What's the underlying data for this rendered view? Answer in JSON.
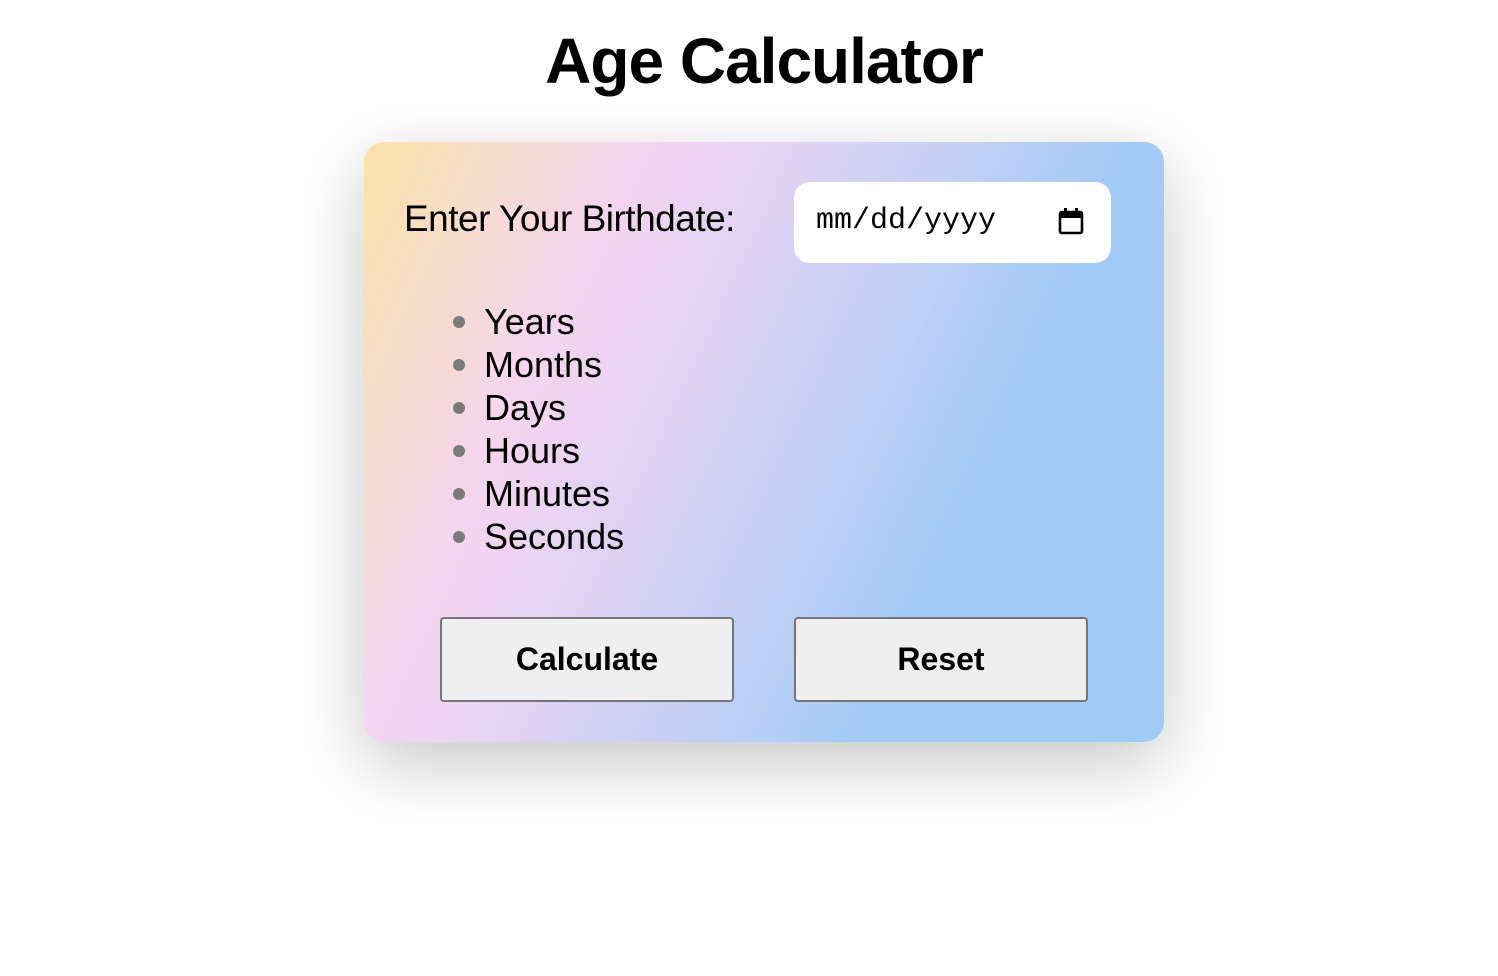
{
  "page": {
    "title": "Age Calculator"
  },
  "form": {
    "birthdate_label": "Enter Your Birthdate:",
    "date_placeholder": "mm/dd/yyyy"
  },
  "units": [
    {
      "label": "Years"
    },
    {
      "label": "Months"
    },
    {
      "label": "Days"
    },
    {
      "label": "Hours"
    },
    {
      "label": "Minutes"
    },
    {
      "label": "Seconds"
    }
  ],
  "buttons": {
    "calculate_label": "Calculate",
    "reset_label": "Reset"
  },
  "colors": {
    "gradient_start": "#f8e4a6",
    "gradient_mid": "#f5d5ef",
    "gradient_end": "#a0cbf6",
    "button_bg": "#efefef"
  },
  "icons": {
    "date_picker": "calendar-icon"
  }
}
